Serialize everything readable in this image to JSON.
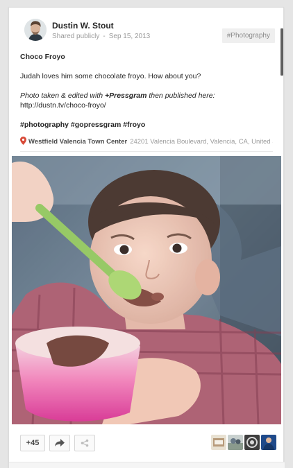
{
  "post": {
    "author": "Dustin W. Stout",
    "visibility": "Shared publicly",
    "separator": "-",
    "date": "Sep 15, 2013",
    "category_tag": "#Photography",
    "title": "Choco Froyo",
    "description": "Judah loves him some chocolate froyo. How about you?",
    "photo_credit_prefix": "Photo taken & edited with ",
    "photo_credit_app": "+Pressgram",
    "photo_credit_suffix": " then published here:",
    "link": "http://dustn.tv/choco-froyo/",
    "hashtags": "#photography #gopressgram #froyo",
    "location_name": "Westfield Valencia Town Center",
    "location_address": "24201 Valencia Boulevard, Valencia, CA, United S…"
  },
  "actions": {
    "plus_one_label": "+45",
    "share_icon": "share-arrow-icon",
    "hangout_icon": "share-nodes-icon"
  },
  "sharers": [
    {
      "name": "sharer-avatar-1"
    },
    {
      "name": "sharer-avatar-2"
    },
    {
      "name": "sharer-avatar-3"
    },
    {
      "name": "sharer-avatar-4"
    }
  ],
  "colors": {
    "location_pin": "#d84a38",
    "background": "#e5e5e5"
  }
}
